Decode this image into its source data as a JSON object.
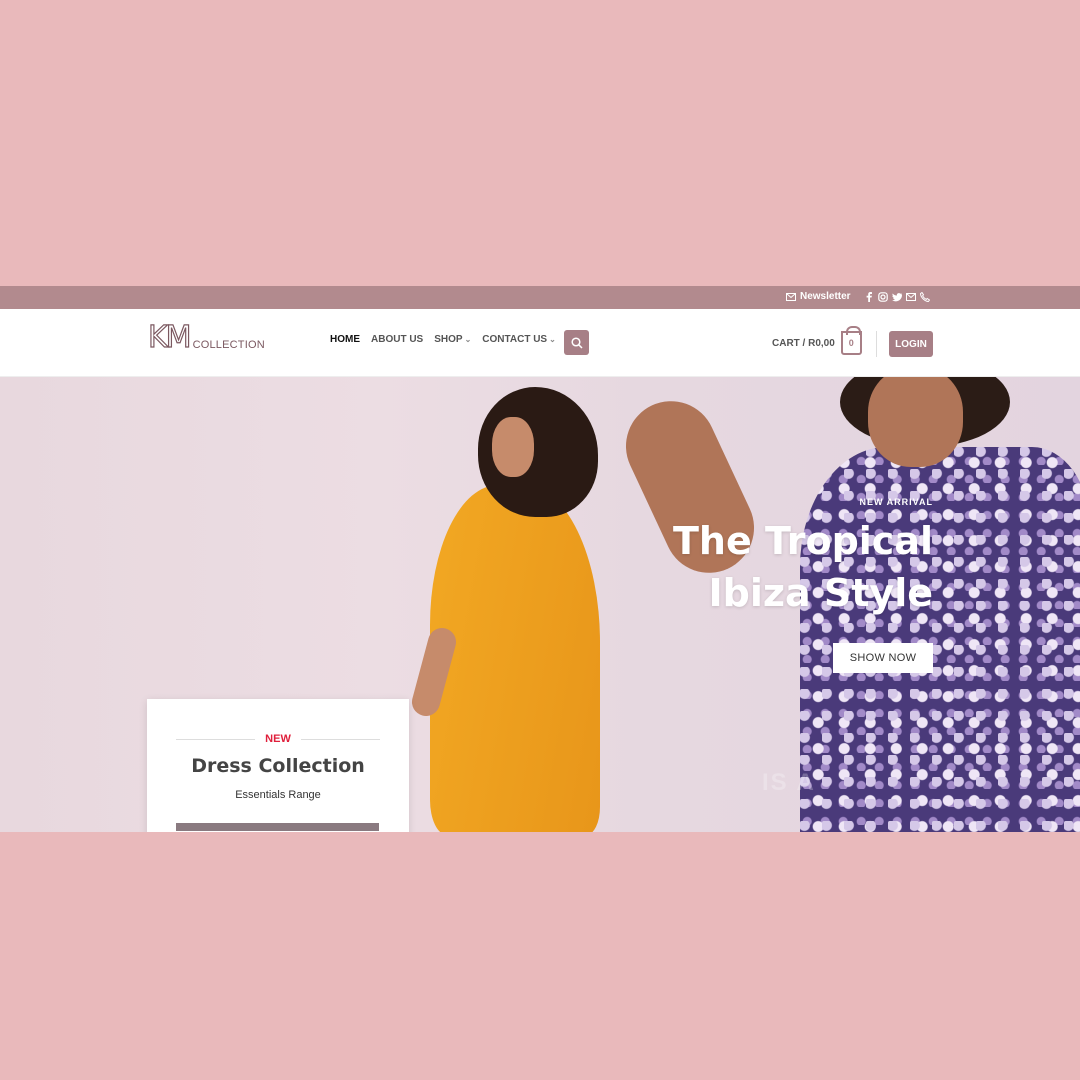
{
  "topbar": {
    "newsletter_label": "Newsletter",
    "social_icons": [
      "facebook-icon",
      "instagram-icon",
      "twitter-icon",
      "mail-icon",
      "phone-icon"
    ]
  },
  "header": {
    "logo_mark": "KM",
    "logo_word": "COLLECTION",
    "nav": [
      {
        "label": "HOME",
        "active": true
      },
      {
        "label": "ABOUT US"
      },
      {
        "label": "SHOP",
        "has_dropdown": true
      },
      {
        "label": "CONTACT US",
        "has_dropdown": true
      }
    ],
    "cart_label": "CART / R0,00",
    "cart_count": "0",
    "login_label": "LOGIN"
  },
  "hero": {
    "kicker": "NEW ARRIVAL",
    "title_line1": "The Tropical",
    "title_line2": "Ibiza Style",
    "button_label": "SHOW NOW",
    "watermark": "IS A"
  },
  "promo": {
    "badge": "NEW",
    "title": "Dress Collection",
    "subtitle": "Essentials Range"
  },
  "colors": {
    "background": "#e9b9bb",
    "topbar": "#b28a8e",
    "accent": "#a77f86",
    "badge_red": "#e0203c"
  }
}
